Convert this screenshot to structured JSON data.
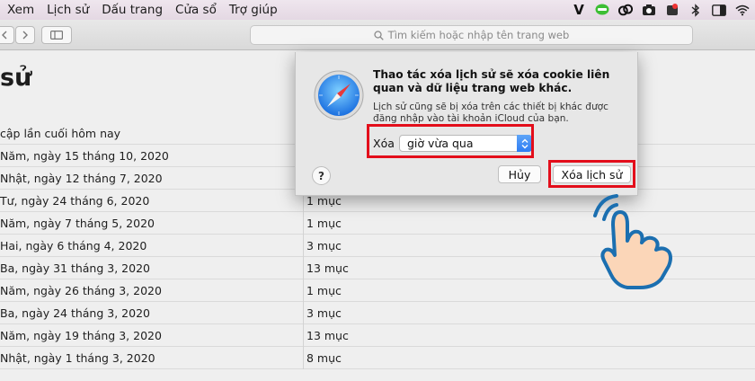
{
  "menubar": {
    "items": [
      "Xem",
      "Lịch sử",
      "Dấu trang",
      "Cửa sổ",
      "Trợ giúp"
    ],
    "status_icons": [
      "viber-icon",
      "line-icon",
      "creative-cloud-icon",
      "camera-icon",
      "hand-icon",
      "bluetooth-icon",
      "sidebar-icon",
      "wifi-icon"
    ]
  },
  "toolbar": {
    "search_placeholder": "Tìm kiếm hoặc nhập tên trang web"
  },
  "page": {
    "title": "sử",
    "last_update": "cập lần cuối hôm nay"
  },
  "history": [
    {
      "date": "Năm, ngày 15 tháng 10, 2020",
      "count": ""
    },
    {
      "date": "Nhật, ngày 12 tháng 7, 2020",
      "count": ""
    },
    {
      "date": "Tư, ngày 24 tháng 6, 2020",
      "count": "1 mục"
    },
    {
      "date": "Năm, ngày 7 tháng 5, 2020",
      "count": "1 mục"
    },
    {
      "date": "Hai, ngày 6 tháng 4, 2020",
      "count": "3 mục"
    },
    {
      "date": "Ba, ngày 31 tháng 3, 2020",
      "count": "13 mục"
    },
    {
      "date": "Năm, ngày 26 tháng 3, 2020",
      "count": "1 mục"
    },
    {
      "date": "Ba, ngày 24 tháng 3, 2020",
      "count": "3 mục"
    },
    {
      "date": "Năm, ngày 19 tháng 3, 2020",
      "count": "13 mục"
    },
    {
      "date": "Nhật, ngày 1 tháng 3, 2020",
      "count": "8 mục"
    }
  ],
  "dialog": {
    "title": "Thao tác xóa lịch sử sẽ xóa cookie liên quan và dữ liệu trang web khác.",
    "body": "Lịch sử cũng sẽ bị xóa trên các thiết bị khác được đăng nhập vào tài khoản iCloud của bạn.",
    "clear_label": "Xóa",
    "selected_range": "giờ vừa qua",
    "help_label": "?",
    "cancel_label": "Hủy",
    "confirm_label": "Xóa lịch sử",
    "highlight_color": "#e30e1b"
  }
}
